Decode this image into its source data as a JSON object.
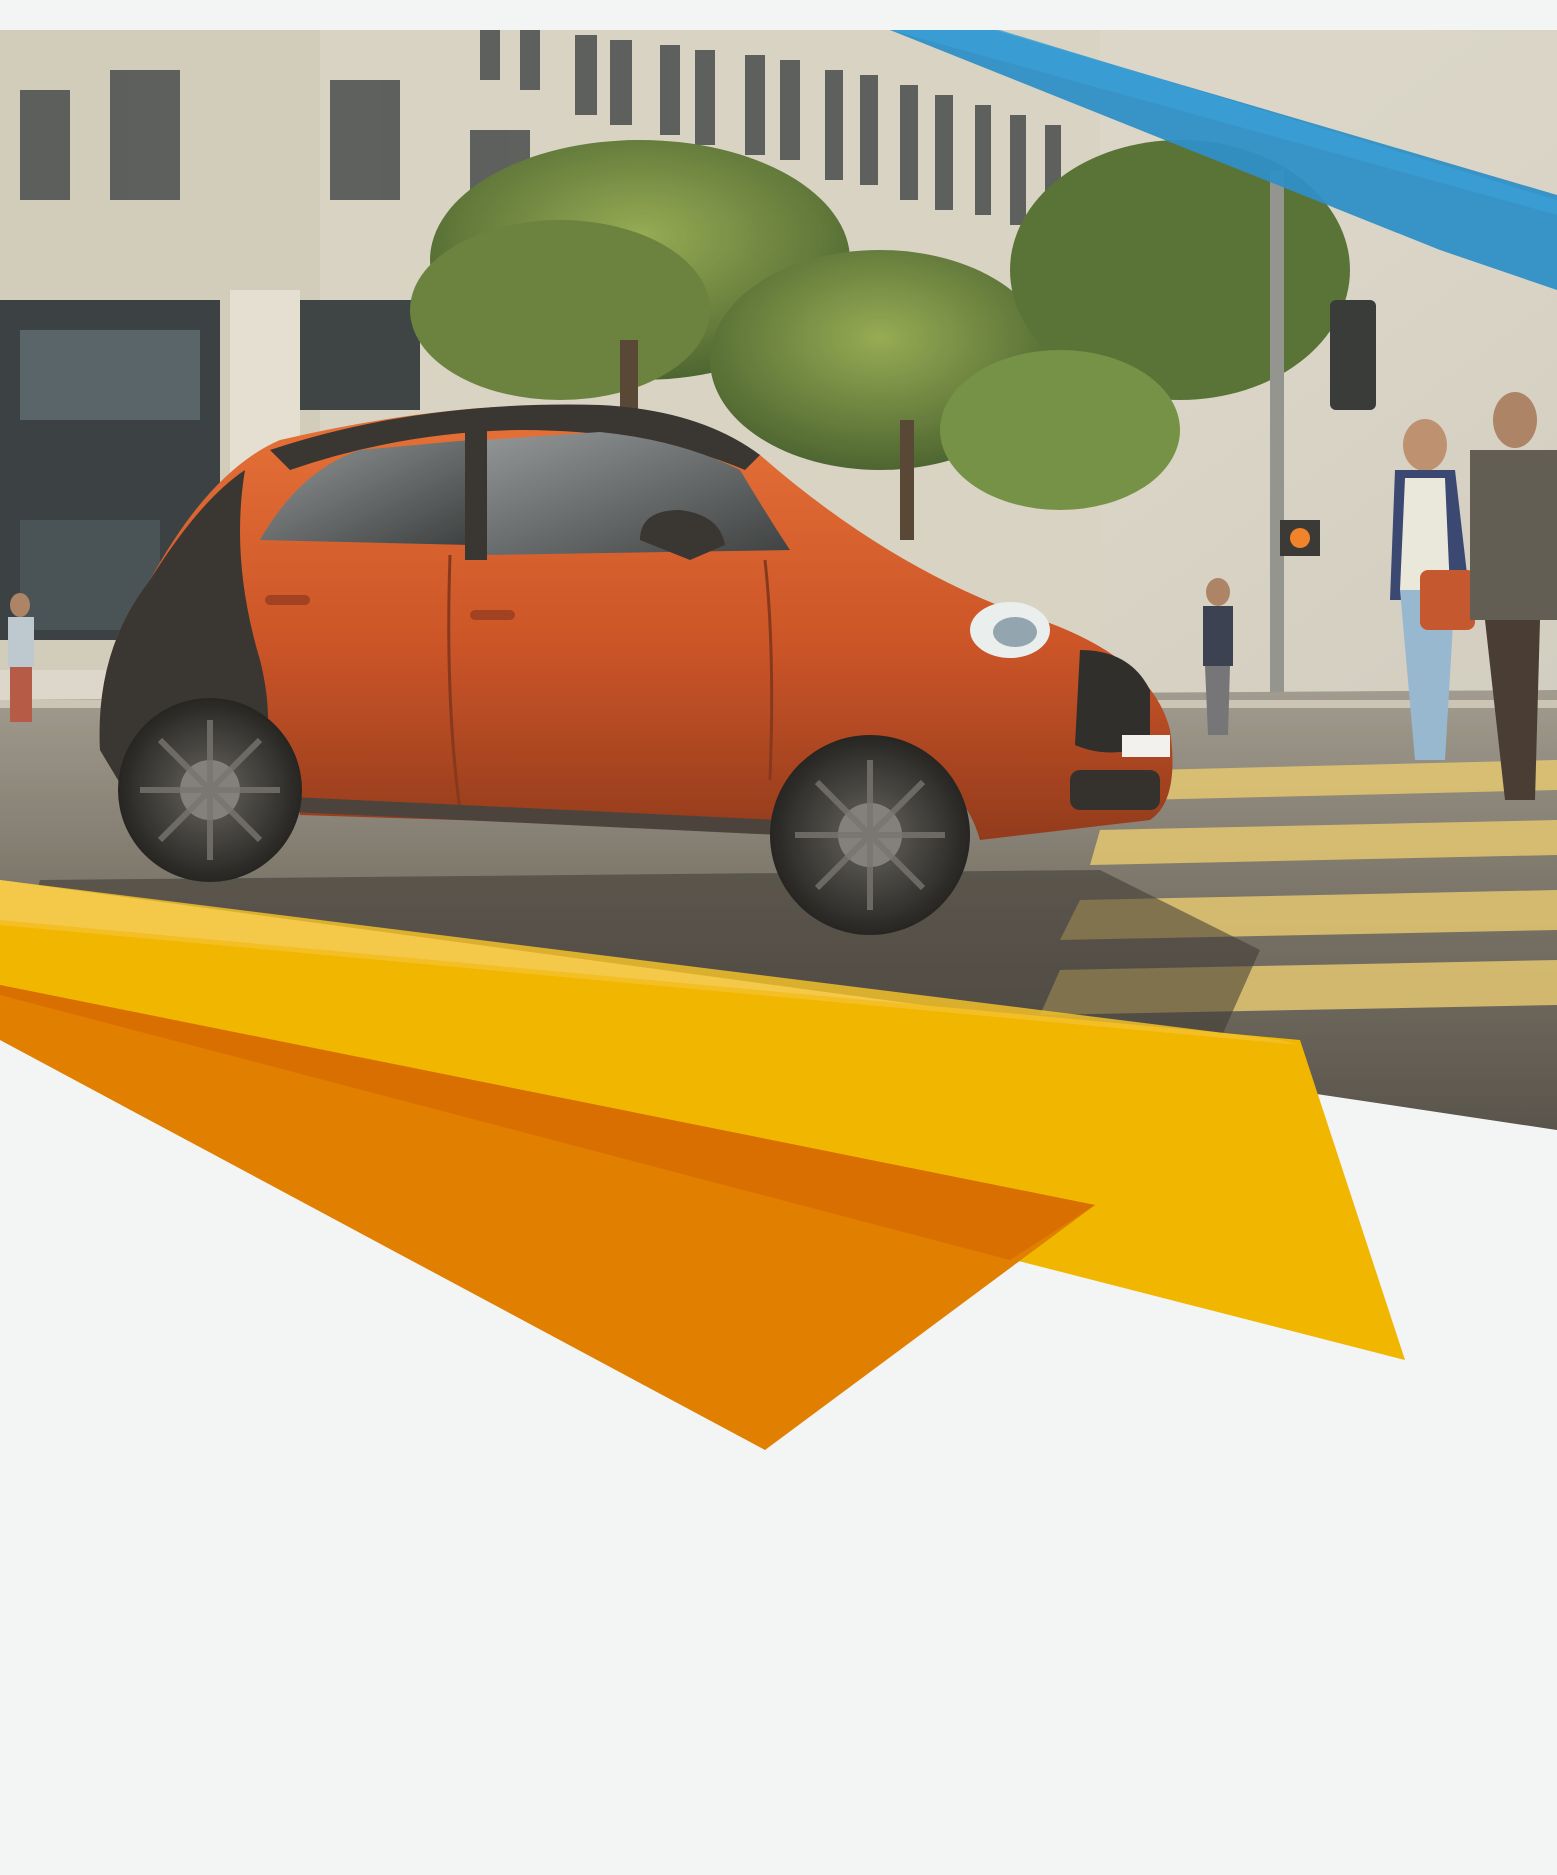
{
  "page": {
    "title": ""
  },
  "colors": {
    "page_background": "#f3f4f4",
    "accent_blue": "#2f8fc6",
    "accent_yellow": "#f0b600",
    "accent_orange": "#e07f00",
    "accent_orange_dark": "#d96f00",
    "car_body": "#c8481a",
    "car_roof": "#2a2624"
  },
  "hero_photo": {
    "subject": "orange-compact-car-city-street",
    "icon": "photo-icon"
  },
  "decor": {
    "left_yellow_ribbon": "yellow-ribbon-shape",
    "left_orange_ribbon": "orange-ribbon-shape",
    "right_blue_ribbon": "blue-ribbon-shape"
  }
}
